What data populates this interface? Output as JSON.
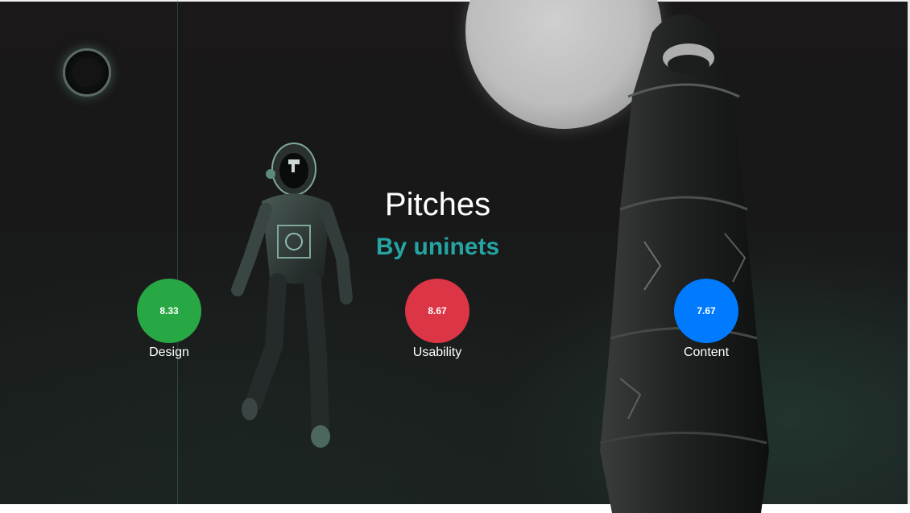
{
  "page": {
    "title": "Pitches",
    "subtitle": "By uninets"
  },
  "colors": {
    "subtitle": "#26a4a4",
    "design": "#28a745",
    "usability": "#dc3545",
    "content": "#007bff"
  },
  "scores": [
    {
      "value": "8.33",
      "label": "Design"
    },
    {
      "value": "8.67",
      "label": "Usability"
    },
    {
      "value": "7.67",
      "label": "Content"
    }
  ],
  "decor": {
    "background_art": [
      "astronaut",
      "moon",
      "rocket-tower",
      "ring"
    ]
  }
}
